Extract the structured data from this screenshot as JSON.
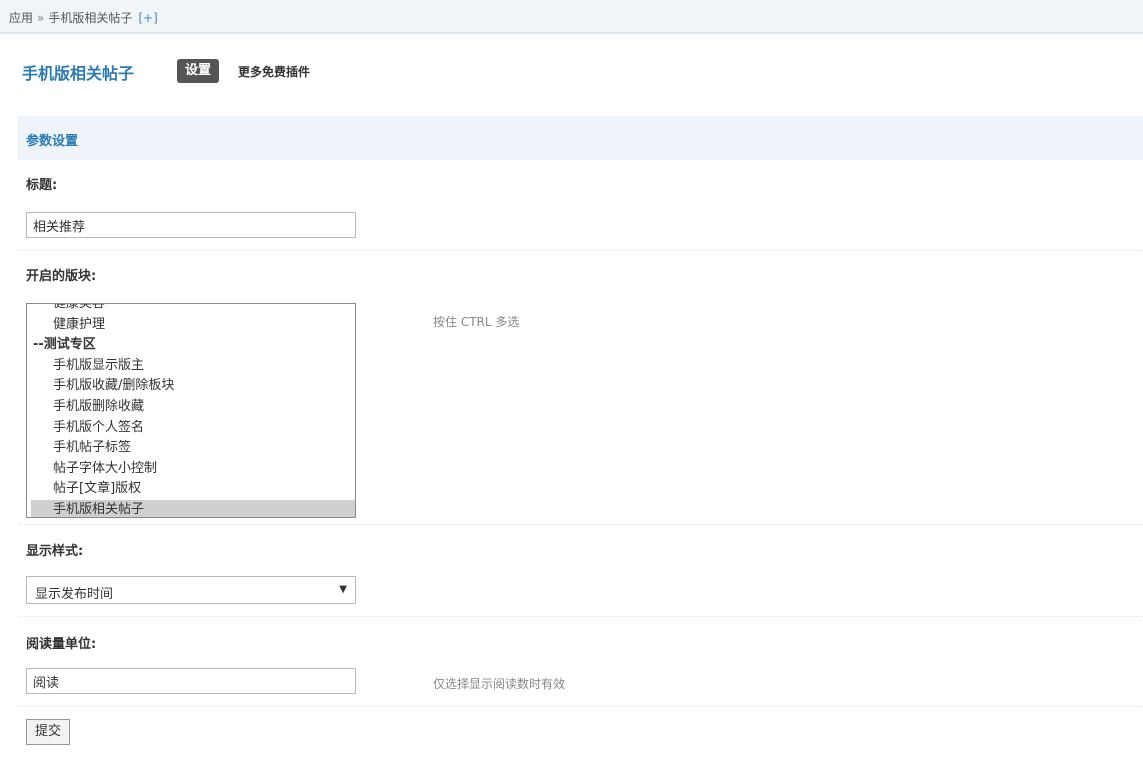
{
  "breadcrumb": {
    "root": "应用",
    "separator": "»",
    "current": "手机版相关帖子",
    "add": "[+]"
  },
  "header": {
    "title": "手机版相关帖子",
    "settings_label": "设置",
    "more_plugins": "更多免费插件"
  },
  "section": {
    "title": "参数设置"
  },
  "fields": {
    "title": {
      "label": "标题:",
      "value": "相关推荐"
    },
    "boards": {
      "label": "开启的版块:",
      "hint": "按住 CTRL 多选",
      "options": [
        {
          "label": "健康美容",
          "group": false,
          "selected": false
        },
        {
          "label": "健康护理",
          "group": false,
          "selected": false
        },
        {
          "label": "--测试专区",
          "group": true,
          "selected": false
        },
        {
          "label": "手机版显示版主",
          "group": false,
          "selected": false
        },
        {
          "label": "手机版收藏/删除板块",
          "group": false,
          "selected": false
        },
        {
          "label": "手机版删除收藏",
          "group": false,
          "selected": false
        },
        {
          "label": "手机版个人签名",
          "group": false,
          "selected": false
        },
        {
          "label": "手机帖子标签",
          "group": false,
          "selected": false
        },
        {
          "label": "帖子字体大小控制",
          "group": false,
          "selected": false
        },
        {
          "label": "帖子[文章]版权",
          "group": false,
          "selected": false
        },
        {
          "label": "手机版相关帖子",
          "group": false,
          "selected": true
        }
      ]
    },
    "style": {
      "label": "显示样式:",
      "value": "显示发布时间"
    },
    "unit": {
      "label": "阅读量单位:",
      "value": "阅读",
      "hint": "仅选择显示阅读数时有效"
    }
  },
  "submit_label": "提交"
}
